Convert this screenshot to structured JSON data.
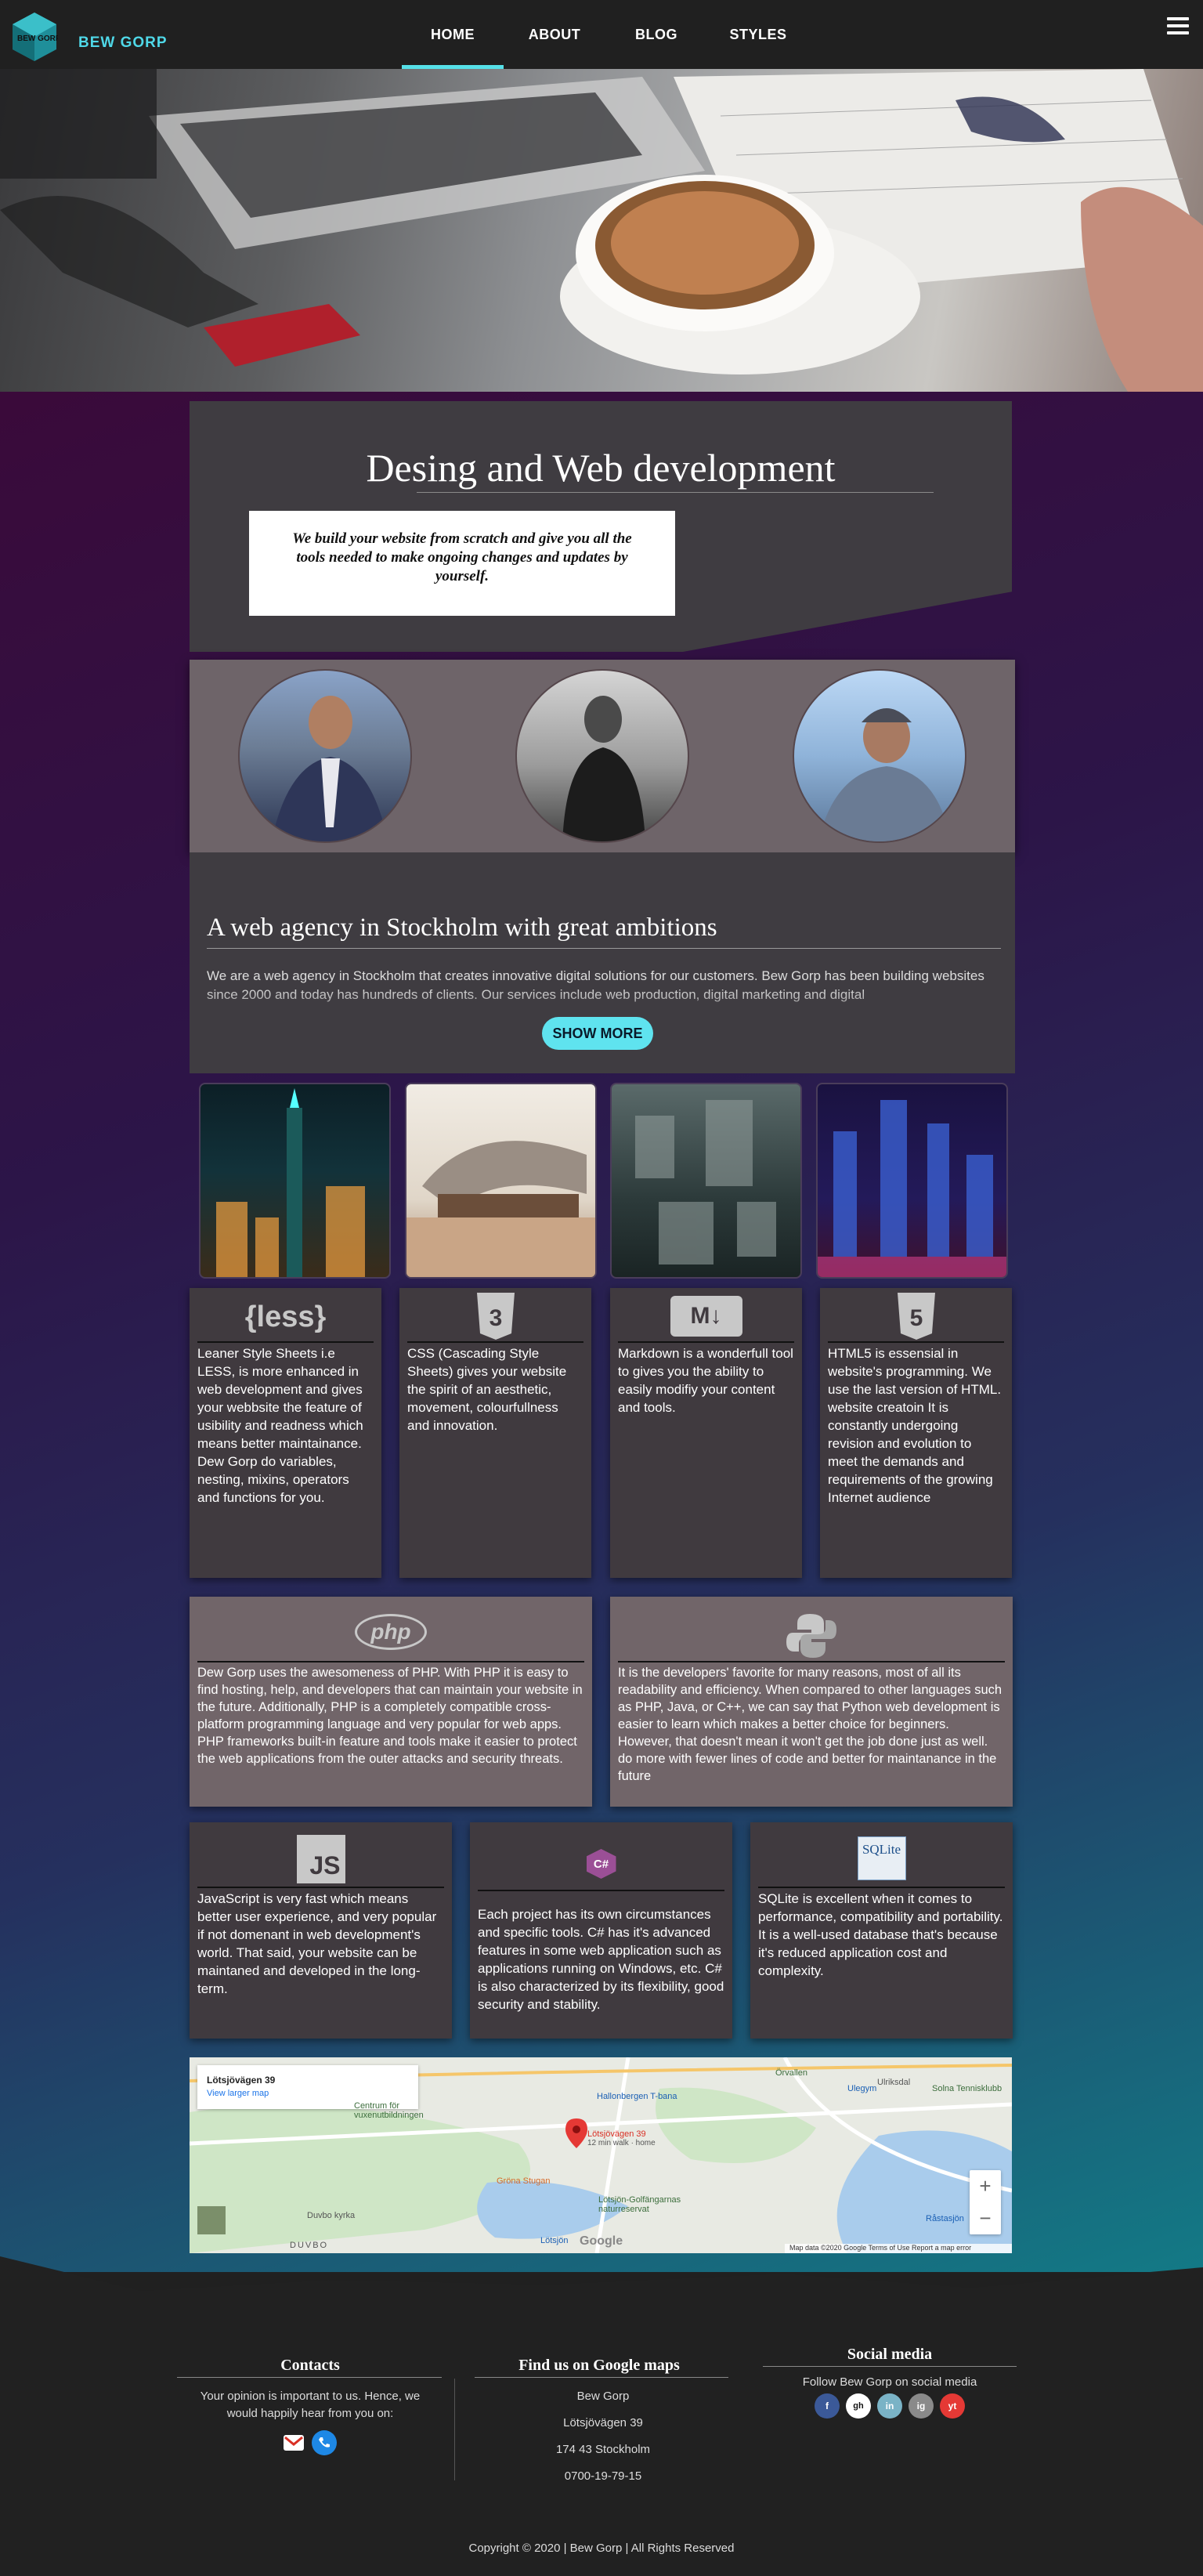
{
  "nav": {
    "brand": "BEW GORP",
    "logo_text": "BEW GORP",
    "items": [
      {
        "label": "HOME",
        "active": true
      },
      {
        "label": "ABOUT",
        "active": false
      },
      {
        "label": "BLOG",
        "active": false
      },
      {
        "label": "STYLES",
        "active": false
      }
    ]
  },
  "intro": {
    "title": "Desing and Web development",
    "box_text": "We build your website from scratch and give you all the tools needed to make ongoing changes and updates by yourself."
  },
  "agency": {
    "title": "A web agency in Stockholm with great ambitions",
    "text": "We are a web agency in Stockholm that creates innovative digital solutions for our customers. Bew Gorp has been building websites since 2000 and today has hundreds of clients. Our services include web production, digital marketing and digital",
    "button": "SHOW MORE"
  },
  "tech": {
    "less": {
      "icon": "{less}",
      "text": "Leaner Style Sheets i.e LESS, is more enhanced in web development and gives your webbsite the feature of usibility and readness which means better maintainance. Dew Gorp do variables, nesting, mixins, operators and functions for you."
    },
    "css": {
      "icon": "3",
      "text": "CSS (Cascading Style Sheets) gives your website the spirit of an aesthetic, movement, colourfullness and innovation."
    },
    "markdown": {
      "icon": "M↓",
      "text": "Markdown is a wonderfull tool to gives you the ability to easily modifiy your content and tools."
    },
    "html": {
      "icon": "5",
      "text": "HTML5 is essensial in website's programming. We use the last version of HTML. website creatoin It is constantly undergoing revision and evolution to meet the demands and requirements of the growing Internet audience"
    },
    "php": {
      "icon": "php",
      "text": "Dew Gorp uses the awesomeness of PHP. With PHP it is easy to find hosting, help, and developers that can maintain your website in the future. Additionally, PHP is a completely compatible cross-platform programming language and very popular for web apps. PHP frameworks built-in feature and tools make it easier to protect the web applications from the outer attacks and security threats."
    },
    "python": {
      "text": "It is the developers' favorite for many reasons, most of all its readability and efficiency. When compared to other languages such as PHP, Java, or C++, we can say that Python web development is easier to learn which makes a better choice for beginners. However, that doesn't mean it won't get the job done just as well. do more with fewer lines of code and better for maintanance in the future"
    },
    "js": {
      "icon": "JS",
      "text": "JavaScript is very fast which means better user experience, and very popular if not domenant in web development's world. That said, your website can be maintaned and developed in the long-term."
    },
    "csharp": {
      "icon": "C#",
      "text": "Each project has its own circumstances and specific tools. C# has it's advanced features in some web application such as applications running on Windows, etc. C# is also characterized by its flexibility, good security and stability."
    },
    "sqlite": {
      "icon": "SQLite",
      "text": "SQLite is excellent when it comes to performance, compatibility and portability. It is a well-used database that's because it's reduced application cost and complexity."
    }
  },
  "map": {
    "place": "Lötsjövägen 39",
    "link": "View larger map",
    "pin_label": "Lötsjövägen 39",
    "pin_sub": "12 min walk · home",
    "labels": [
      "Centrum för vuxenutbildningen",
      "Hallonbergen T-bana",
      "Örvallen",
      "Ulriksdal",
      "Ulegym",
      "Solna Tennisklubb",
      "Gröna Stugan",
      "Lötsjön-Golfängarnas naturreservat",
      "Duvbo kyrka",
      "DUVBO",
      "Lötsjön",
      "Råstasjön"
    ],
    "attribution": "Map data ©2020 Google   Terms of Use   Report a map error",
    "google": "Google",
    "zoom_in": "+",
    "zoom_out": "−"
  },
  "footer": {
    "contacts_title": "Contacts",
    "contacts_text": "Your opinion is important to us. Hence, we would happily hear from you on:",
    "maps_title": "Find us on Google maps",
    "address": [
      "Bew Gorp",
      "Lötsjövägen 39",
      "174 43 Stockholm",
      "0700-19-79-15"
    ],
    "social_title": "Social media",
    "social_text": "Follow Bew Gorp on social media",
    "social_icons": [
      "f",
      "gh",
      "in",
      "ig",
      "yt"
    ],
    "copyright": "Copyright © 2020 | Bew Gorp | All Rights Reserved"
  }
}
